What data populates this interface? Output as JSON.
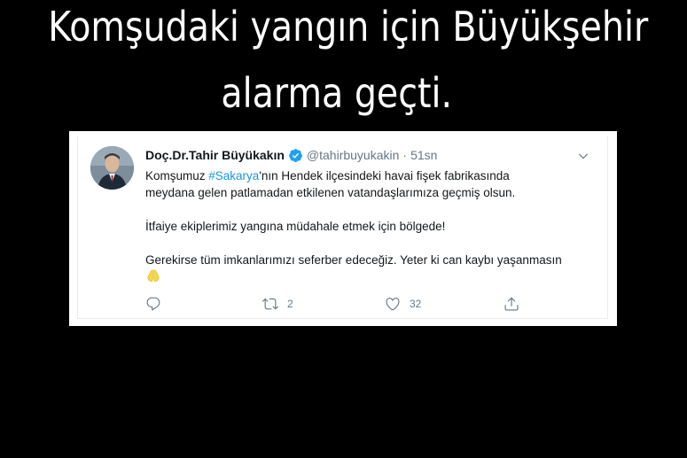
{
  "headline": {
    "line1": "Komşudaki yangın için Büyükşehir",
    "line2": "alarma geçti."
  },
  "tweet": {
    "author_name": "Doç.Dr.Tahir Büyükakın",
    "handle": "@tahirbuyukakin",
    "separator": "·",
    "time": "51sn",
    "text_line1_before": "Komşumuz ",
    "hashtag": "#Sakarya",
    "text_line1_after": "'nın Hendek ilçesindeki havai fişek fabrikasında",
    "text_line2": "meydana gelen patlamadan etkilenen vatandaşlarımıza geçmiş olsun.",
    "paragraph2": "İtfaiye ekiplerimiz yangına müdahale etmek için bölgede!",
    "paragraph3": "Gerekirse tüm imkanlarımızı seferber edeceğiz. Yeter ki can kaybı yaşanmasın",
    "emoji": "praying-hands-emoji",
    "retweet_count": "2",
    "like_count": "32"
  },
  "icons": {
    "verified": "verified-badge-icon",
    "caret": "chevron-down-icon",
    "reply": "reply-icon",
    "retweet": "retweet-icon",
    "like": "heart-icon",
    "share": "share-icon"
  },
  "colors": {
    "background": "#000000",
    "headline": "#ffffff",
    "link": "#1b95e0",
    "muted": "#657786",
    "verified": "#1da1f2"
  }
}
